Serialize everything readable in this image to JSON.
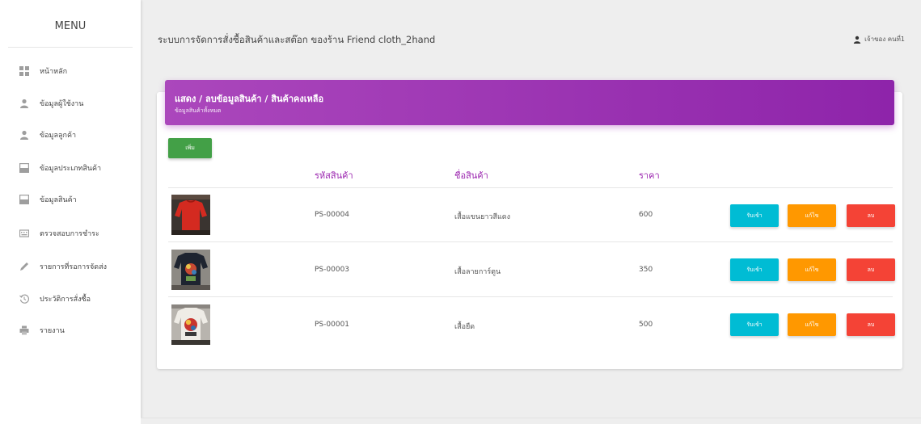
{
  "sidebar": {
    "title": "MENU",
    "items": [
      {
        "label": "หน้าหลัก",
        "icon": "dashboard-icon"
      },
      {
        "label": "ข้อมูลผู้ใช้งาน",
        "icon": "person-icon"
      },
      {
        "label": "ข้อมูลลูกค้า",
        "icon": "person-icon"
      },
      {
        "label": "ข้อมูลประเภทสินค้า",
        "icon": "inbox-icon"
      },
      {
        "label": "ข้อมูลสินค้า",
        "icon": "inbox-icon"
      },
      {
        "label": "ตรวจสอบการชำระ",
        "icon": "keyboard-icon"
      },
      {
        "label": "รายการที่รอการจัดส่ง",
        "icon": "pencil-icon"
      },
      {
        "label": "ประวัติการสั่งซื้อ",
        "icon": "history-icon"
      },
      {
        "label": "รายงาน",
        "icon": "print-icon"
      }
    ]
  },
  "header": {
    "title": "ระบบการจัดการสั่งซื้อสินค้าและสต๊อก ของร้าน Friend cloth_2hand",
    "user_label": "เจ้าของ คนที่1"
  },
  "card": {
    "title": "แสดง / ลบข้อมูลสินค้า / สินค้าคงเหลือ",
    "subtitle": "ข้อมูลสินค้าทั้งหมด",
    "add_label": "เพิ่ม",
    "accent": "#9c27b0",
    "columns": [
      "รหัสสินค้า",
      "ชื่อสินค้า",
      "ราคา"
    ],
    "rows": [
      {
        "code": "PS-00004",
        "name": "เสื้อแขนยาวสีแดง",
        "price": "600",
        "image": "red-long-sleeve-shirt"
      },
      {
        "code": "PS-00003",
        "name": "เสื้อลายการ์ตูน",
        "price": "350",
        "image": "cartoon-print-shirt"
      },
      {
        "code": "PS-00001",
        "name": "เสื้อยืด",
        "price": "500",
        "image": "t-shirt"
      }
    ],
    "actions": {
      "view": "รับเข้า",
      "edit": "แก้ไข",
      "delete": "ลบ"
    },
    "action_colors": {
      "view": "#00bcd4",
      "edit": "#ff9800",
      "delete": "#f44336"
    }
  }
}
